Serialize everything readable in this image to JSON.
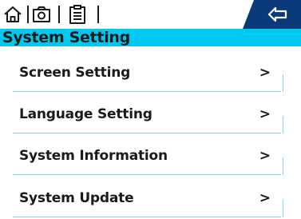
{
  "colors": {
    "accent": "#00c8ef",
    "back_button_bg": "#0a3a7a",
    "divider": "#7fd8ef",
    "text": "#1a1a1a"
  },
  "toolbar": {
    "icons": [
      "home-icon",
      "camera-icon",
      "clipboard-icon"
    ],
    "back_icon": "back-arrow-icon"
  },
  "header": {
    "title": "System Setting"
  },
  "menu": {
    "items": [
      {
        "label": "Screen Setting",
        "chevron": ">"
      },
      {
        "label": "Language Setting",
        "chevron": ">"
      },
      {
        "label": "System Information",
        "chevron": ">"
      },
      {
        "label": "System Update",
        "chevron": ">"
      }
    ]
  }
}
